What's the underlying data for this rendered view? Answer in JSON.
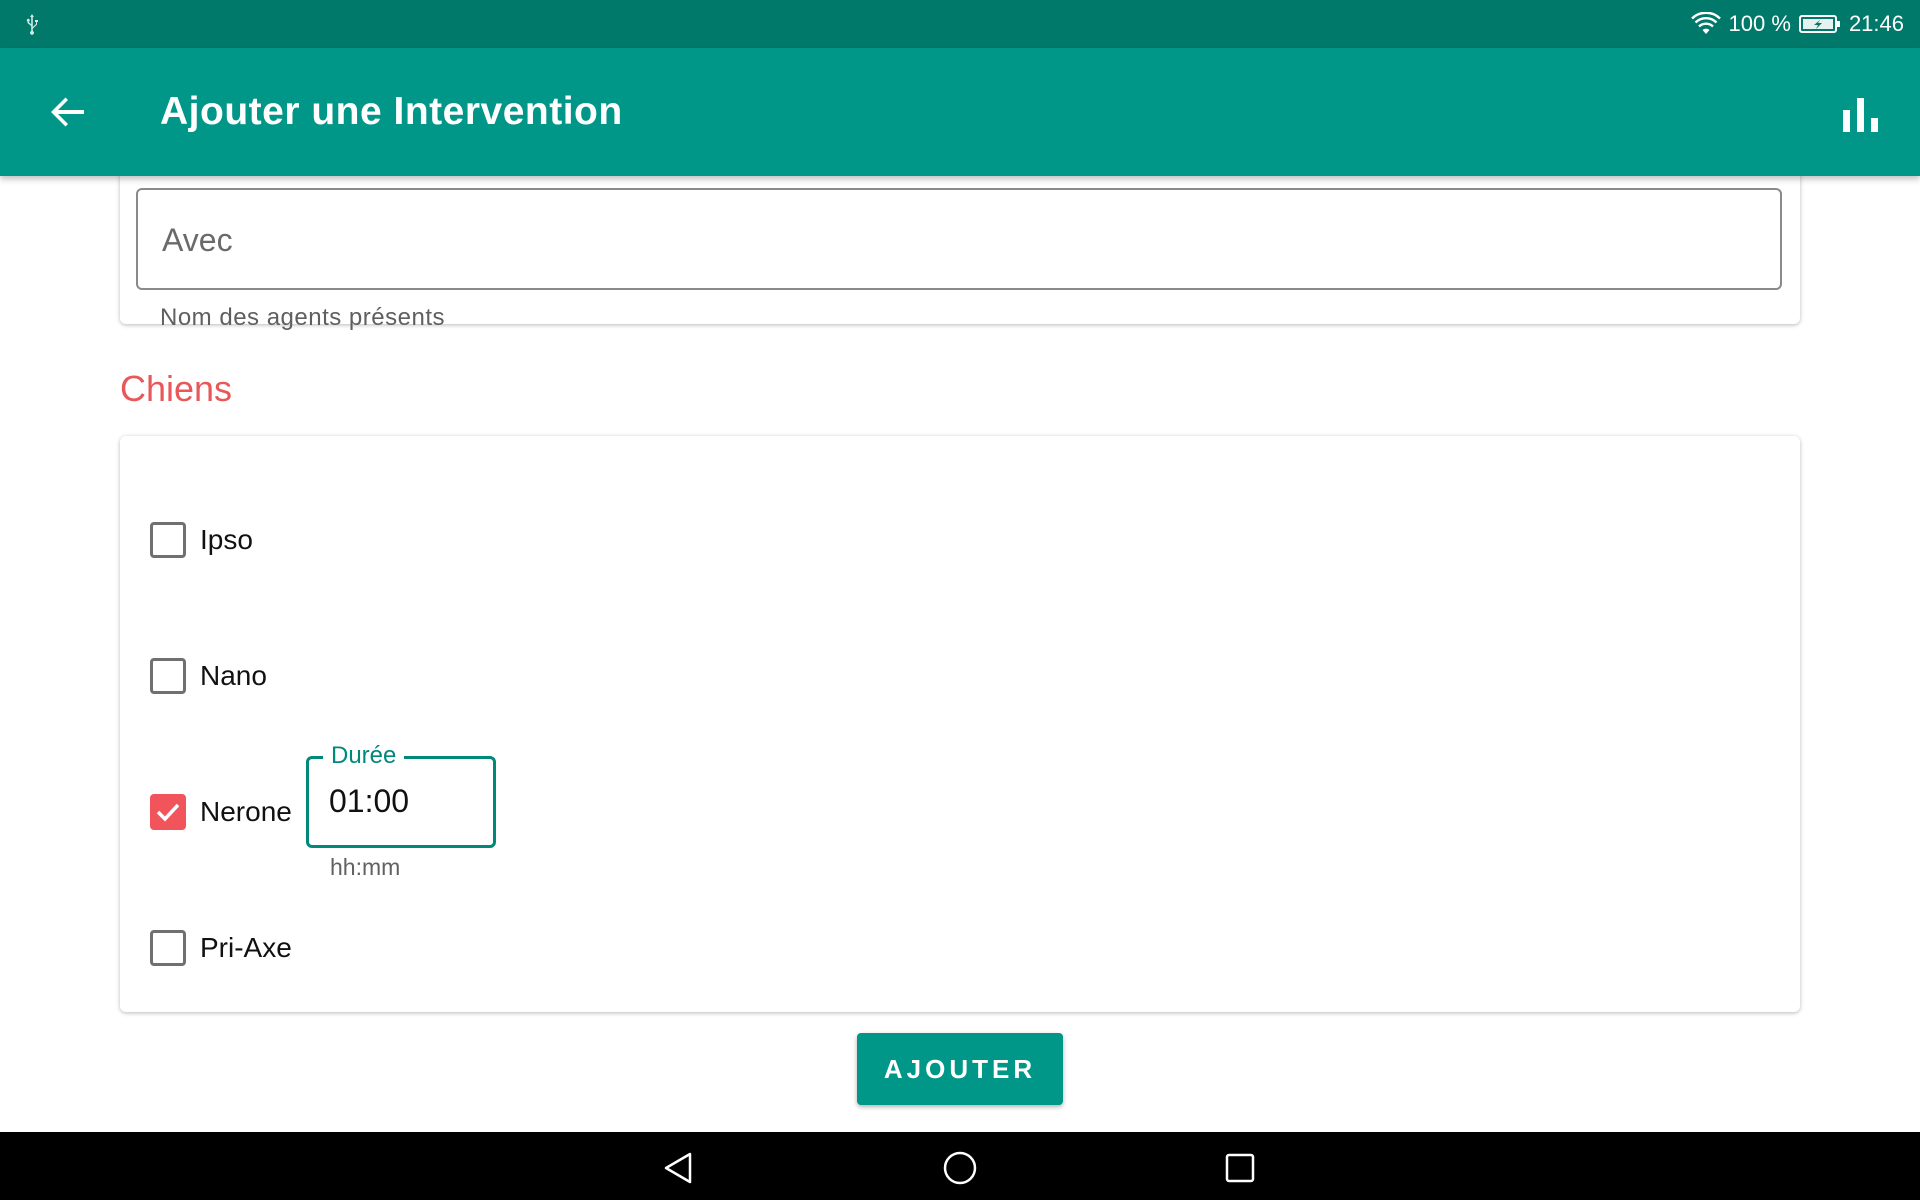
{
  "status_bar": {
    "wifi_icon": "wifi-icon",
    "battery_percent": "100 %",
    "battery_icon": "battery-charging-icon",
    "time": "21:46",
    "usb_icon": "usb-icon"
  },
  "app_bar": {
    "title": "Ajouter une Intervention",
    "back_icon": "arrow-back-icon",
    "action_icon": "bar-chart-icon"
  },
  "form": {
    "avec_placeholder": "Avec",
    "avec_value": "",
    "avec_helper": "Nom des agents présents"
  },
  "dogs_section": {
    "title": "Chiens",
    "dogs": [
      {
        "name": "Ipso",
        "checked": false
      },
      {
        "name": "Nano",
        "checked": false
      },
      {
        "name": "Nerone",
        "checked": true
      },
      {
        "name": "Pri-Axe",
        "checked": false
      }
    ],
    "duration": {
      "label": "Durée",
      "value": "01:00",
      "helper": "hh:mm"
    }
  },
  "submit_label": "AJOUTER",
  "colors": {
    "status_bar": "#00796b",
    "primary": "#009688",
    "accent": "#f2545b",
    "section_title": "#e8575a"
  },
  "nav_bar": {
    "back_icon": "nav-back-icon",
    "home_icon": "nav-home-icon",
    "recents_icon": "nav-recents-icon"
  }
}
